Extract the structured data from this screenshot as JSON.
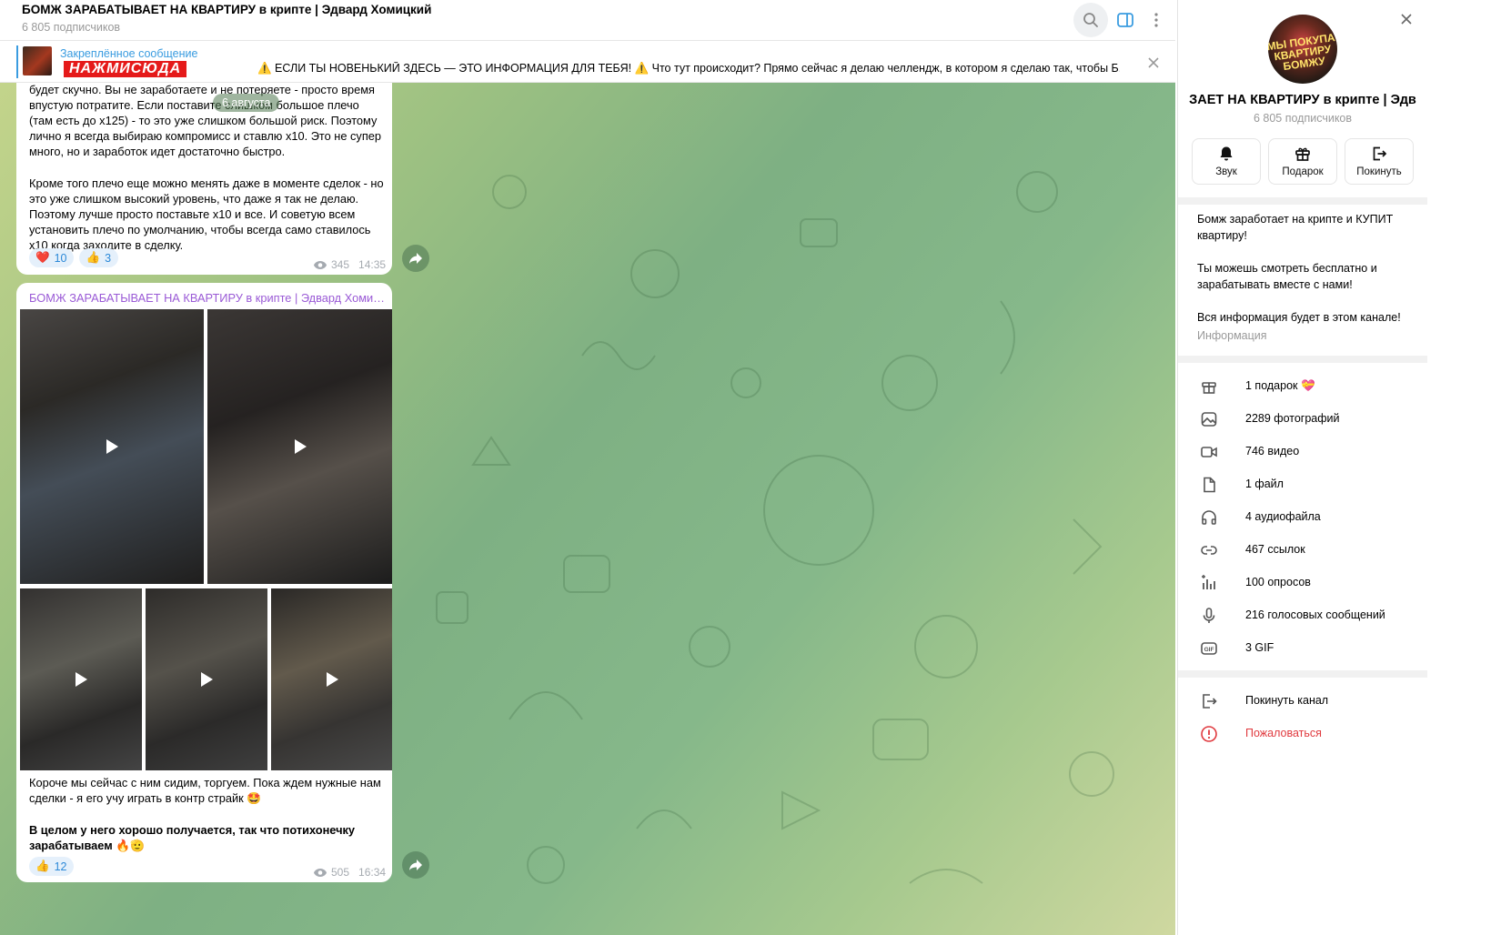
{
  "chat": {
    "title": "БОМЖ ЗАРАБАТЫВАЕТ НА КВАРТИРУ в крипте | Эдвард Хомицкий",
    "subscribers": "6 805 подписчиков"
  },
  "pinned": {
    "label": "Закреплённое сообщение",
    "banner": "НАЖМИСЮДА",
    "text": "⚠️ ЕСЛИ ТЫ НОВЕНЬКИЙ ЗДЕСЬ — ЭТО ИНФОРМАЦИЯ ДЛЯ ТЕБЯ! ⚠️  Что тут происходит? Прямо сейчас я делаю челлендж, в котором я сделаю так, чтобы Б..."
  },
  "date_pill": "6 августа",
  "message1": {
    "text": "будет скучно. Вы не заработаете и не потеряете - просто время впустую потратите. Если поставите слишком большое плечо (там есть до x125) - то это уже слишком большой риск. Поэтому лично я всегда выбираю компромисс и ставлю x10. Это не супер много, но и заработок идет достаточно быстро.\n\nКроме того плечо еще можно менять даже в моменте сделок - но это уже слишком высокий уровень, что даже я так не делаю. Поэтому лучше просто поставьте x10 и все. И советую всем установить плечо по умолчанию, чтобы всегда само ставилось x10 когда заходите в сделку.",
    "reactions": [
      {
        "emoji": "❤️",
        "count": "10"
      },
      {
        "emoji": "👍",
        "count": "3"
      }
    ],
    "views": "345",
    "time": "14:35"
  },
  "message2": {
    "author": "БОМЖ ЗАРАБАТЫВАЕТ НА КВАРТИРУ в крипте | Эдвард Хомицкий",
    "text": "Короче мы сейчас с ним сидим, торгуем. Пока ждем нужные нам сделки - я его учу играть в контр страйк 🤩",
    "bold_text": "В целом у него хорошо получается, так что потихонечку зарабатываем 🔥🫡",
    "reactions": [
      {
        "emoji": "👍",
        "count": "12"
      }
    ],
    "views": "505",
    "time": "16:34"
  },
  "info": {
    "avatar_text": "МЫ ПОКУПАЕМ\nКВАРТИРУ\nБОМЖУ",
    "name": "ЗАЕТ НА КВАРТИРУ в крипте | Эдв",
    "subscribers": "6 805 подписчиков",
    "actions": {
      "sound": "Звук",
      "gift": "Подарок",
      "leave": "Покинуть"
    },
    "description": "Бомж заработает на крипте и КУПИТ квартиру!\n\nТы можешь смотреть бесплатно и зарабатывать вместе с нами!\n\nВся информация будет в этом канале!",
    "description_label": "Информация",
    "stats": {
      "gifts": "1 подарок",
      "gift_emoji": "💝",
      "photos": "2289 фотографий",
      "videos": "746 видео",
      "files": "1 файл",
      "audio": "4 аудиофайла",
      "links": "467 ссылок",
      "polls": "100 опросов",
      "voice": "216 голосовых сообщений",
      "gif": "3 GIF"
    },
    "leave_channel": "Покинуть канал",
    "report": "Пожаловаться"
  },
  "colors": {
    "accent": "#3a9ce0",
    "author": "#9a5ad6",
    "danger": "#e0393e",
    "banner": "#e51a1a"
  }
}
